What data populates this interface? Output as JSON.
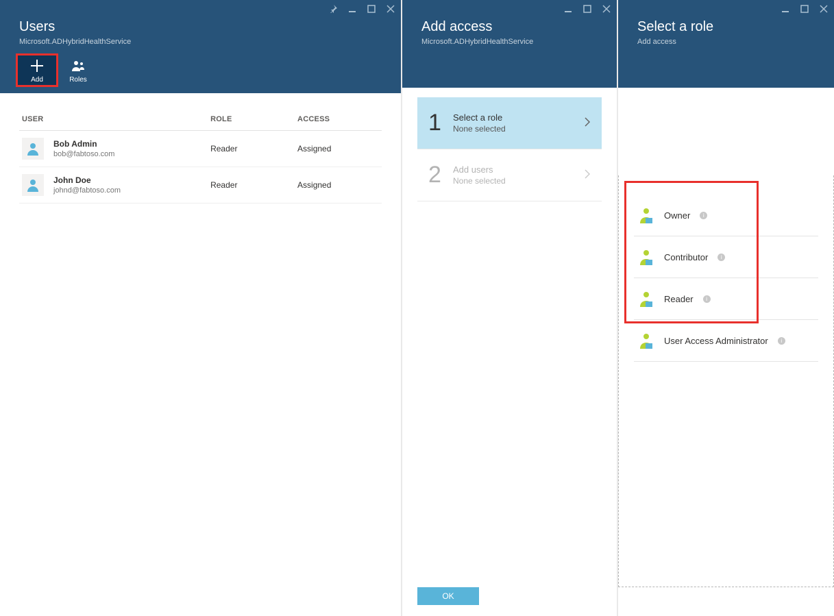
{
  "blade1": {
    "title": "Users",
    "subtitle": "Microsoft.ADHybridHealthService",
    "toolbar": {
      "add": "Add",
      "roles": "Roles"
    },
    "columns": {
      "user": "USER",
      "role": "ROLE",
      "access": "ACCESS"
    },
    "rows": [
      {
        "name": "Bob Admin",
        "email": "bob@fabtoso.com",
        "role": "Reader",
        "access": "Assigned"
      },
      {
        "name": "John Doe",
        "email": "johnd@fabtoso.com",
        "role": "Reader",
        "access": "Assigned"
      }
    ]
  },
  "blade2": {
    "title": "Add access",
    "subtitle": "Microsoft.ADHybridHealthService",
    "step1": {
      "num": "1",
      "title": "Select a role",
      "sub": "None selected"
    },
    "step2": {
      "num": "2",
      "title": "Add users",
      "sub": "None selected"
    },
    "ok": "OK"
  },
  "blade3": {
    "title": "Select a role",
    "subtitle": "Add access",
    "roles": [
      {
        "label": "Owner"
      },
      {
        "label": "Contributor"
      },
      {
        "label": "Reader"
      },
      {
        "label": "User Access Administrator"
      }
    ]
  }
}
